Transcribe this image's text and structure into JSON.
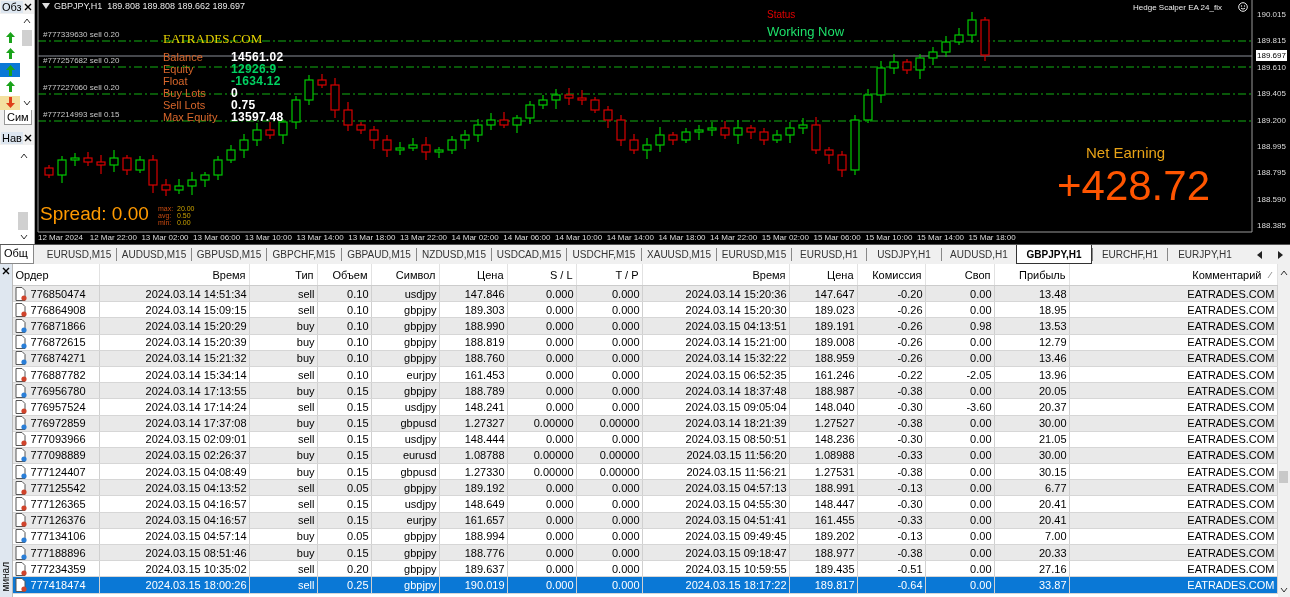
{
  "market_watch": {
    "title": "Обз",
    "rows": [
      {
        "kind": "up",
        "selected": false
      },
      {
        "kind": "up",
        "selected": false
      },
      {
        "kind": "up",
        "selected": true
      },
      {
        "kind": "up",
        "selected": false
      },
      {
        "kind": "down",
        "selected": false
      }
    ],
    "tab": "Сим"
  },
  "navigator": {
    "title": "Нав"
  },
  "chart": {
    "header": "GBPJPY,H1  189.808 189.808 189.662 189.697",
    "order_lines": [
      {
        "label": "#777339630 sell 0.20"
      },
      {
        "label": "#777257682 sell 0.20"
      },
      {
        "label": "#777227060 sell 0.20"
      },
      {
        "label": "#777214993 sell 0.15"
      }
    ],
    "brand": "EATRADES.COM",
    "stats": [
      {
        "label": "Balance",
        "value": "14561.02",
        "color": "#ffffff"
      },
      {
        "label": "Equity",
        "value": "12926.9",
        "color": "#00d060"
      },
      {
        "label": "Float",
        "value": "-1634.12",
        "color": "#00d060"
      },
      {
        "label": "Buy Lots",
        "value": "0",
        "color": "#ffffff"
      },
      {
        "label": "Sell Lots",
        "value": "0.75",
        "color": "#ffffff"
      },
      {
        "label": "Max Equity",
        "value": "13597.48",
        "color": "#ffffff"
      }
    ],
    "spread": "Spread: 0.00",
    "spread_stats": [
      {
        "label": "max:",
        "value": "20.00"
      },
      {
        "label": "avg:",
        "value": "0.50"
      },
      {
        "label": "min:",
        "value": "0.00"
      }
    ],
    "status_label": "Status",
    "status": "Working Now",
    "ea_name": "Hedge Scalper EA 24_fix",
    "net_label": "Net Earning",
    "net_value": "+428.72",
    "price_axis": [
      {
        "label": "190.015",
        "current": false
      },
      {
        "label": "189.815",
        "current": false
      },
      {
        "label": "189.697",
        "current": true
      },
      {
        "label": "189.610",
        "current": false
      },
      {
        "label": "189.405",
        "current": false
      },
      {
        "label": "189.200",
        "current": false
      },
      {
        "label": "188.995",
        "current": false
      },
      {
        "label": "188.795",
        "current": false
      },
      {
        "label": "188.590",
        "current": false
      },
      {
        "label": "188.385",
        "current": false
      }
    ],
    "time_axis": [
      "12 Mar 2024",
      "12 Mar 22:00",
      "13 Mar 02:00",
      "13 Mar 06:00",
      "13 Mar 10:00",
      "13 Mar 14:00",
      "13 Mar 18:00",
      "13 Mar 22:00",
      "14 Mar 02:00",
      "14 Mar 06:00",
      "14 Mar 10:00",
      "14 Mar 14:00",
      "14 Mar 18:00",
      "14 Mar 22:00",
      "15 Mar 02:00",
      "15 Mar 06:00",
      "15 Mar 10:00",
      "15 Mar 14:00",
      "15 Mar 18:00"
    ]
  },
  "chart_tabs": [
    {
      "label": "EURUSD,M15",
      "selected": false
    },
    {
      "label": "AUDUSD,M15",
      "selected": false
    },
    {
      "label": "GBPUSD,M15",
      "selected": false
    },
    {
      "label": "GBPCHF,M15",
      "selected": false
    },
    {
      "label": "GBPAUD,M15",
      "selected": false
    },
    {
      "label": "NZDUSD,M15",
      "selected": false
    },
    {
      "label": "USDCAD,M15",
      "selected": false
    },
    {
      "label": "USDCHF,M15",
      "selected": false
    },
    {
      "label": "XAUUSD,M15",
      "selected": false
    },
    {
      "label": "EURUSD,M15",
      "selected": false
    },
    {
      "label": "EURUSD,H1",
      "selected": false
    },
    {
      "label": "USDJPY,H1",
      "selected": false
    },
    {
      "label": "AUDUSD,H1",
      "selected": false
    },
    {
      "label": "GBPJPY,H1",
      "selected": true
    },
    {
      "label": "EURCHF,H1",
      "selected": false
    },
    {
      "label": "EURJPY,H1",
      "selected": false
    }
  ],
  "terminal": {
    "side_tab": "Общ",
    "title": "минал",
    "columns": [
      "Ордер",
      "Время",
      "Тип",
      "Объем",
      "Символ",
      "Цена",
      "S / L",
      "T / P",
      "Время",
      "Цена",
      "Комиссия",
      "Своп",
      "Прибыль",
      "Комментарий"
    ],
    "rows": [
      {
        "kind": "sell",
        "selected": false,
        "cells": [
          "776850474",
          "2024.03.14 14:51:34",
          "sell",
          "0.10",
          "usdjpy",
          "147.846",
          "0.000",
          "0.000",
          "2024.03.14 15:20:36",
          "147.647",
          "-0.20",
          "0.00",
          "13.48",
          "EATRADES.COM"
        ]
      },
      {
        "kind": "sell",
        "selected": false,
        "cells": [
          "776864908",
          "2024.03.14 15:09:15",
          "sell",
          "0.10",
          "gbpjpy",
          "189.303",
          "0.000",
          "0.000",
          "2024.03.14 15:20:30",
          "189.023",
          "-0.26",
          "0.00",
          "18.95",
          "EATRADES.COM"
        ]
      },
      {
        "kind": "buy",
        "selected": false,
        "cells": [
          "776871866",
          "2024.03.14 15:20:29",
          "buy",
          "0.10",
          "gbpjpy",
          "188.990",
          "0.000",
          "0.000",
          "2024.03.15 04:13:51",
          "189.191",
          "-0.26",
          "0.98",
          "13.53",
          "EATRADES.COM"
        ]
      },
      {
        "kind": "buy",
        "selected": false,
        "cells": [
          "776872615",
          "2024.03.14 15:20:39",
          "buy",
          "0.10",
          "gbpjpy",
          "188.819",
          "0.000",
          "0.000",
          "2024.03.14 15:21:00",
          "189.008",
          "-0.26",
          "0.00",
          "12.79",
          "EATRADES.COM"
        ]
      },
      {
        "kind": "buy",
        "selected": false,
        "cells": [
          "776874271",
          "2024.03.14 15:21:32",
          "buy",
          "0.10",
          "gbpjpy",
          "188.760",
          "0.000",
          "0.000",
          "2024.03.14 15:32:22",
          "188.959",
          "-0.26",
          "0.00",
          "13.46",
          "EATRADES.COM"
        ]
      },
      {
        "kind": "sell",
        "selected": false,
        "cells": [
          "776887782",
          "2024.03.14 15:34:14",
          "sell",
          "0.10",
          "eurjpy",
          "161.453",
          "0.000",
          "0.000",
          "2024.03.15 06:52:35",
          "161.246",
          "-0.22",
          "-2.05",
          "13.96",
          "EATRADES.COM"
        ]
      },
      {
        "kind": "buy",
        "selected": false,
        "cells": [
          "776956780",
          "2024.03.14 17:13:55",
          "buy",
          "0.15",
          "gbpjpy",
          "188.789",
          "0.000",
          "0.000",
          "2024.03.14 18:37:48",
          "188.987",
          "-0.38",
          "0.00",
          "20.05",
          "EATRADES.COM"
        ]
      },
      {
        "kind": "sell",
        "selected": false,
        "cells": [
          "776957524",
          "2024.03.14 17:14:24",
          "sell",
          "0.15",
          "usdjpy",
          "148.241",
          "0.000",
          "0.000",
          "2024.03.15 09:05:04",
          "148.040",
          "-0.30",
          "-3.60",
          "20.37",
          "EATRADES.COM"
        ]
      },
      {
        "kind": "buy",
        "selected": false,
        "cells": [
          "776972859",
          "2024.03.14 17:37:08",
          "buy",
          "0.15",
          "gbpusd",
          "1.27327",
          "0.00000",
          "0.00000",
          "2024.03.14 18:21:39",
          "1.27527",
          "-0.38",
          "0.00",
          "30.00",
          "EATRADES.COM"
        ]
      },
      {
        "kind": "sell",
        "selected": false,
        "cells": [
          "777093966",
          "2024.03.15 02:09:01",
          "sell",
          "0.15",
          "usdjpy",
          "148.444",
          "0.000",
          "0.000",
          "2024.03.15 08:50:51",
          "148.236",
          "-0.30",
          "0.00",
          "21.05",
          "EATRADES.COM"
        ]
      },
      {
        "kind": "buy",
        "selected": false,
        "cells": [
          "777098889",
          "2024.03.15 02:26:37",
          "buy",
          "0.15",
          "eurusd",
          "1.08788",
          "0.00000",
          "0.00000",
          "2024.03.15 11:56:20",
          "1.08988",
          "-0.33",
          "0.00",
          "30.00",
          "EATRADES.COM"
        ]
      },
      {
        "kind": "buy",
        "selected": false,
        "cells": [
          "777124407",
          "2024.03.15 04:08:49",
          "buy",
          "0.15",
          "gbpusd",
          "1.27330",
          "0.00000",
          "0.00000",
          "2024.03.15 11:56:21",
          "1.27531",
          "-0.38",
          "0.00",
          "30.15",
          "EATRADES.COM"
        ]
      },
      {
        "kind": "sell",
        "selected": false,
        "cells": [
          "777125542",
          "2024.03.15 04:13:52",
          "sell",
          "0.05",
          "gbpjpy",
          "189.192",
          "0.000",
          "0.000",
          "2024.03.15 04:57:13",
          "188.991",
          "-0.13",
          "0.00",
          "6.77",
          "EATRADES.COM"
        ]
      },
      {
        "kind": "sell",
        "selected": false,
        "cells": [
          "777126365",
          "2024.03.15 04:16:57",
          "sell",
          "0.15",
          "usdjpy",
          "148.649",
          "0.000",
          "0.000",
          "2024.03.15 04:55:30",
          "148.447",
          "-0.30",
          "0.00",
          "20.41",
          "EATRADES.COM"
        ]
      },
      {
        "kind": "sell",
        "selected": false,
        "cells": [
          "777126376",
          "2024.03.15 04:16:57",
          "sell",
          "0.15",
          "eurjpy",
          "161.657",
          "0.000",
          "0.000",
          "2024.03.15 04:51:41",
          "161.455",
          "-0.33",
          "0.00",
          "20.41",
          "EATRADES.COM"
        ]
      },
      {
        "kind": "buy",
        "selected": false,
        "cells": [
          "777134106",
          "2024.03.15 04:57:14",
          "buy",
          "0.05",
          "gbpjpy",
          "188.994",
          "0.000",
          "0.000",
          "2024.03.15 09:49:45",
          "189.202",
          "-0.13",
          "0.00",
          "7.00",
          "EATRADES.COM"
        ]
      },
      {
        "kind": "buy",
        "selected": false,
        "cells": [
          "777188896",
          "2024.03.15 08:51:46",
          "buy",
          "0.15",
          "gbpjpy",
          "188.776",
          "0.000",
          "0.000",
          "2024.03.15 09:18:47",
          "188.977",
          "-0.38",
          "0.00",
          "20.33",
          "EATRADES.COM"
        ]
      },
      {
        "kind": "sell",
        "selected": false,
        "cells": [
          "777234359",
          "2024.03.15 10:35:02",
          "sell",
          "0.20",
          "gbpjpy",
          "189.637",
          "0.000",
          "0.000",
          "2024.03.15 10:59:55",
          "189.435",
          "-0.51",
          "0.00",
          "27.16",
          "EATRADES.COM"
        ]
      },
      {
        "kind": "sell",
        "selected": true,
        "cells": [
          "777418474",
          "2024.03.15 18:00:26",
          "sell",
          "0.25",
          "gbpjpy",
          "190.019",
          "0.000",
          "0.000",
          "2024.03.15 18:17:22",
          "189.817",
          "-0.64",
          "0.00",
          "33.87",
          "EATRADES.COM"
        ]
      }
    ]
  }
}
